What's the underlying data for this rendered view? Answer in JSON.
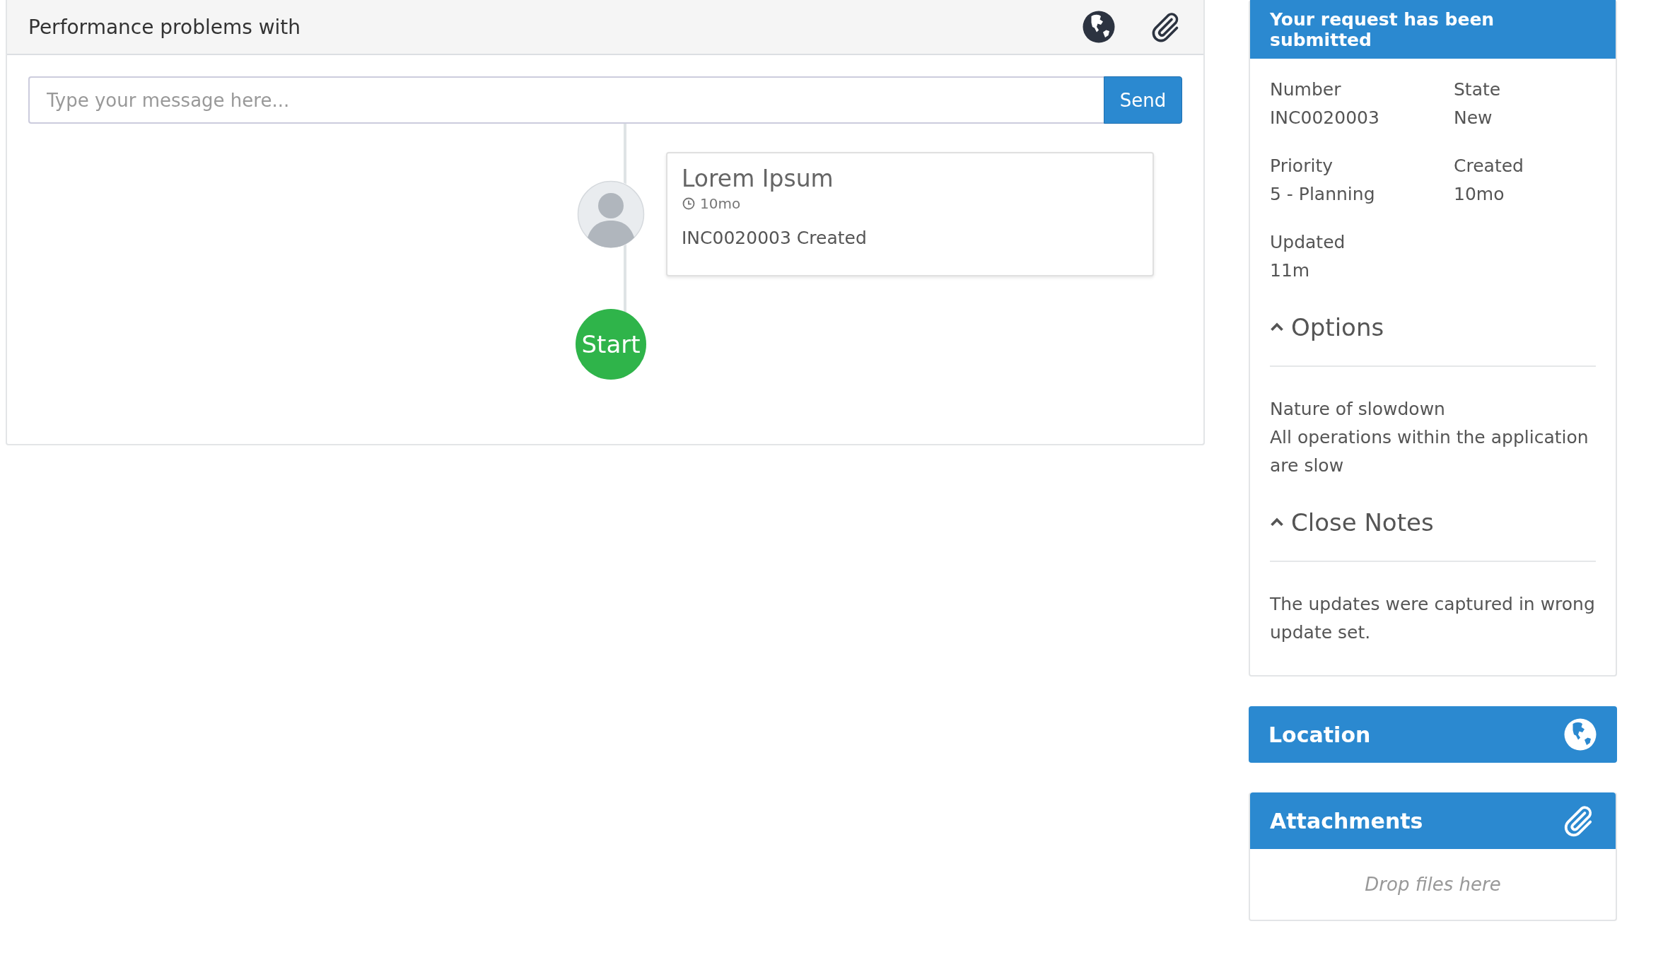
{
  "conversation": {
    "title": "Performance problems with",
    "message_field": {
      "placeholder": "Type your message here..."
    },
    "send_button": "Send",
    "timeline": [
      {
        "author": "Lorem Ipsum",
        "time": "10mo",
        "text": "INC0020003 Created"
      }
    ],
    "start_label": "Start"
  },
  "request_panel": {
    "title": "Your request has been submitted",
    "fields": [
      {
        "label": "Number",
        "value": "INC0020003"
      },
      {
        "label": "State",
        "value": "New"
      },
      {
        "label": "Priority",
        "value": "5 - Planning"
      },
      {
        "label": "Created",
        "value": "10mo"
      },
      {
        "label": "Updated",
        "value": "11m"
      }
    ],
    "sections": [
      {
        "title": "Options",
        "expanded": true,
        "items": [
          {
            "label": "Nature of slowdown",
            "value": "All operations within the application are slow"
          }
        ]
      },
      {
        "title": "Close Notes",
        "expanded": true,
        "items": [
          {
            "value": "The updates were captured in wrong update set."
          }
        ]
      }
    ]
  },
  "location_panel": {
    "title": "Location"
  },
  "attachments_panel": {
    "title": "Attachments",
    "drop_hint": "Drop files here"
  }
}
